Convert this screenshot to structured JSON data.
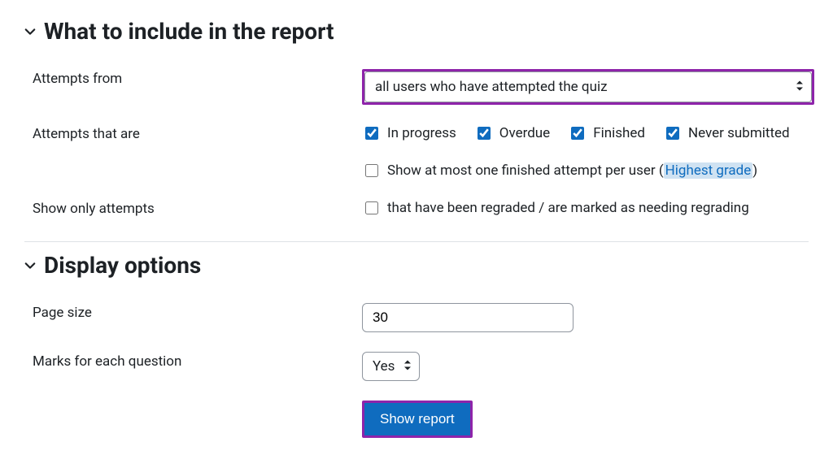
{
  "section1": {
    "heading": "What to include in the report",
    "attempts_from_label": "Attempts from",
    "attempts_from_value": "all users who have attempted the quiz",
    "attempts_that_are_label": "Attempts that are",
    "states": {
      "in_progress": "In progress",
      "overdue": "Overdue",
      "finished": "Finished",
      "never_submitted": "Never submitted"
    },
    "show_at_most_prefix": "Show at most one finished attempt per user (",
    "highest_grade": "Highest grade",
    "show_at_most_suffix": ")",
    "show_only_label": "Show only attempts",
    "regraded_label": "that have been regraded / are marked as needing regrading"
  },
  "section2": {
    "heading": "Display options",
    "page_size_label": "Page size",
    "page_size_value": "30",
    "marks_label": "Marks for each question",
    "marks_value": "Yes"
  },
  "submit_label": "Show report"
}
